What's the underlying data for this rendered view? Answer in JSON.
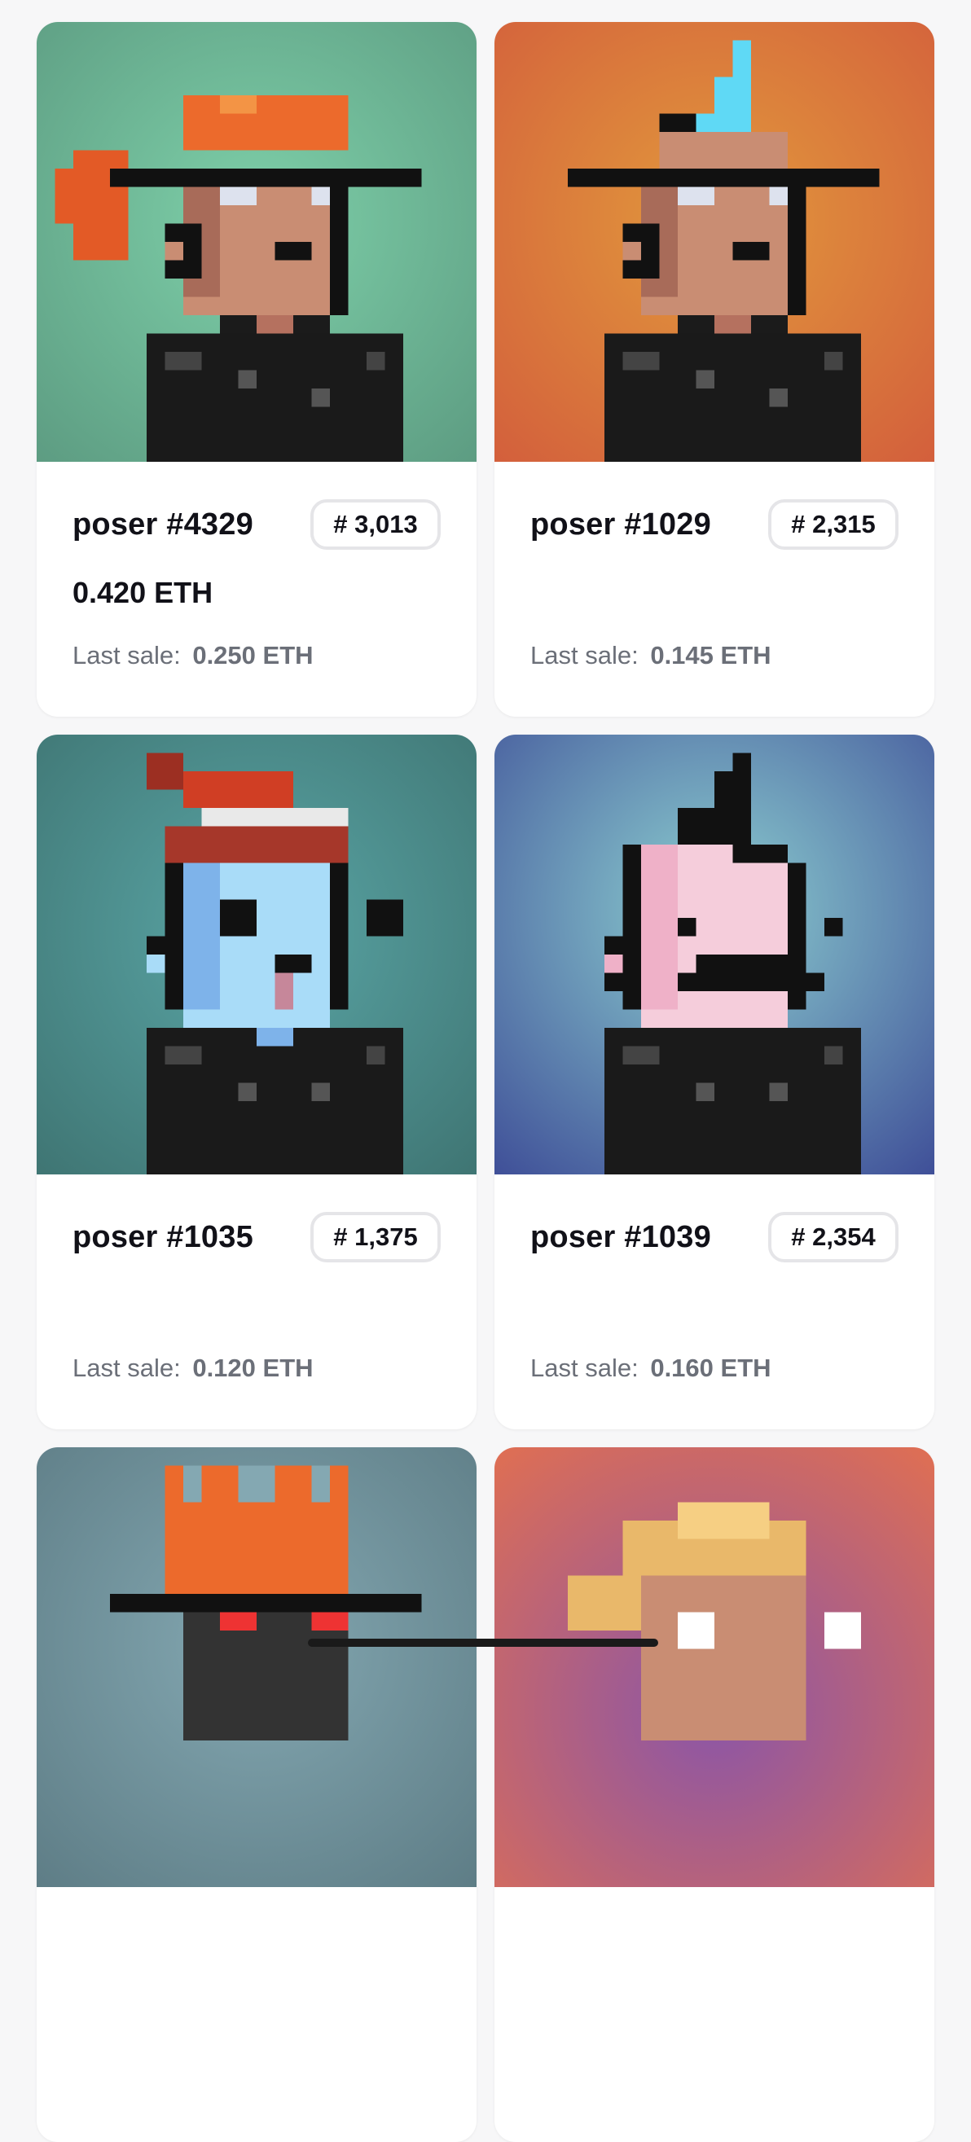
{
  "cards": [
    {
      "name": "poser #4329",
      "rank": "# 3,013",
      "price": "0.420 ETH",
      "last_label": "Last sale:",
      "last_value": "0.250 ETH",
      "bg": "#5d9c82"
    },
    {
      "name": "poser #1029",
      "rank": "# 2,315",
      "price": "",
      "last_label": "Last sale:",
      "last_value": "0.145 ETH",
      "bg": "#d35f3c"
    },
    {
      "name": "poser #1035",
      "rank": "# 1,375",
      "price": "",
      "last_label": "Last sale:",
      "last_value": "0.120 ETH",
      "bg": "#3f7573"
    },
    {
      "name": "poser #1039",
      "rank": "# 2,354",
      "price": "",
      "last_label": "Last sale:",
      "last_value": "0.160 ETH",
      "bg": "#3f4f98"
    }
  ],
  "partial_cards": [
    {
      "bg": "#5e7d86"
    },
    {
      "bg": "#8a55a8"
    }
  ],
  "colors": {
    "text": "#111118",
    "muted": "#6b6f78",
    "badge_border": "#e5e5e8"
  }
}
